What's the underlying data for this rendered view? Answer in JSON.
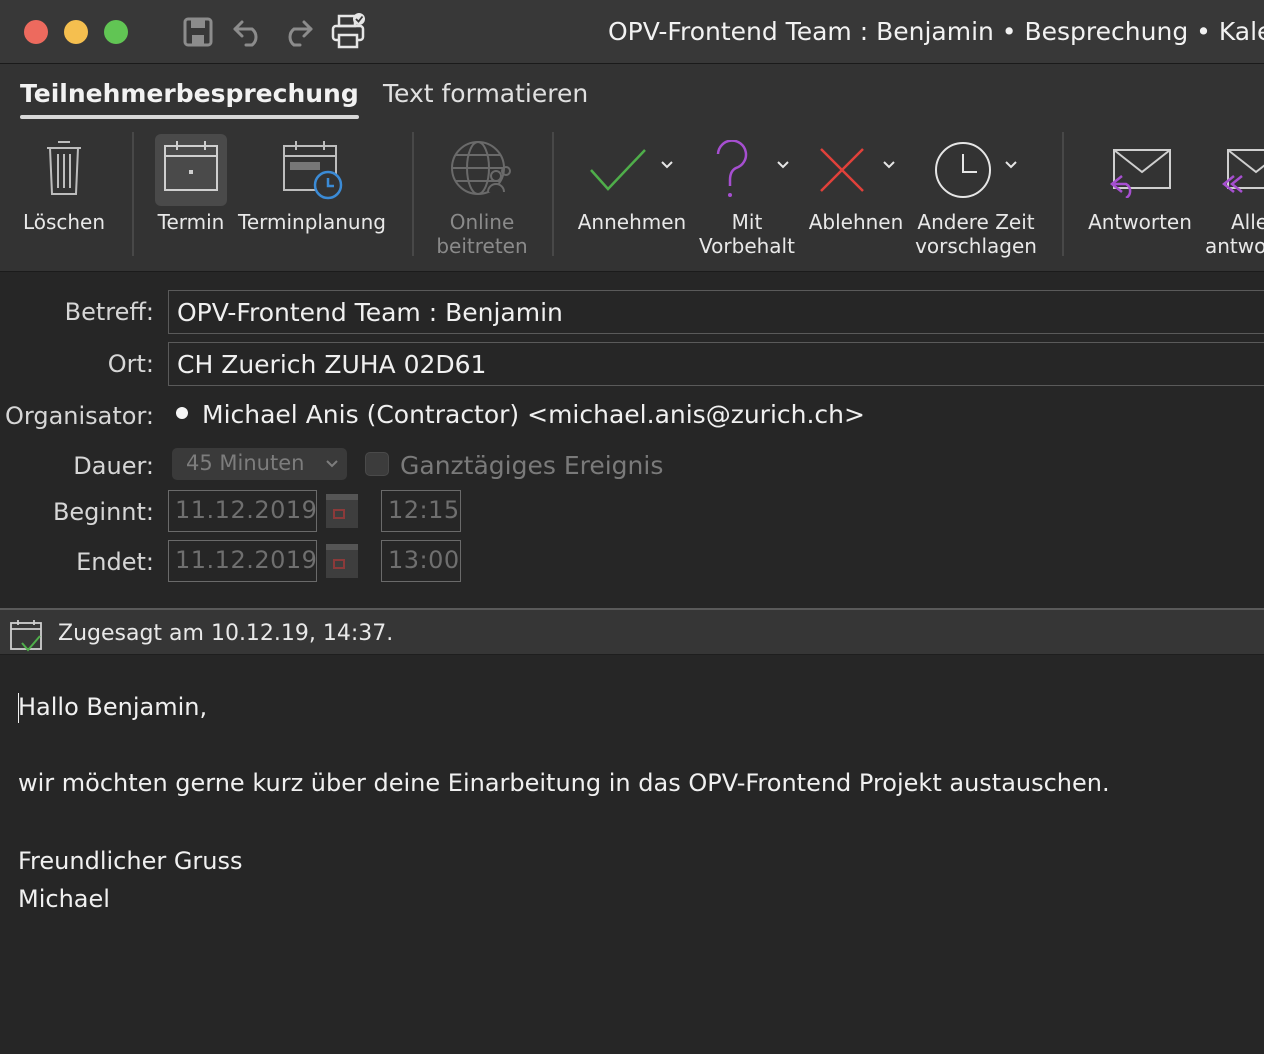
{
  "window": {
    "title": "OPV-Frontend Team : Benjamin • Besprechung • Kalen"
  },
  "tabs": [
    {
      "label": "Teilnehmerbesprechung",
      "active": true
    },
    {
      "label": "Text formatieren",
      "active": false
    }
  ],
  "ribbon": {
    "loeschen": "Löschen",
    "termin": "Termin",
    "terminplanung": "Terminplanung",
    "online_line1": "Online",
    "online_line2": "beitreten",
    "annehmen": "Annehmen",
    "vorbehalt_line1": "Mit",
    "vorbehalt_line2": "Vorbehalt",
    "ablehnen": "Ablehnen",
    "anderezeit_line1": "Andere Zeit",
    "anderezeit_line2": "vorschlagen",
    "antworten": "Antworten",
    "alle_line1": "Alle",
    "alle_line2": "antwo"
  },
  "form": {
    "betreff_label": "Betreff:",
    "betreff_value": "OPV-Frontend Team : Benjamin",
    "ort_label": "Ort:",
    "ort_value": "CH Zuerich ZUHA 02D61",
    "organisator_label": "Organisator:",
    "organisator_value": "Michael Anis (Contractor) <michael.anis@zurich.ch>",
    "dauer_label": "Dauer:",
    "dauer_value": "45 Minuten",
    "ganztaegig_label": "Ganztägiges Ereignis",
    "beginnt_label": "Beginnt:",
    "beginnt_date": "11.12.2019",
    "beginnt_time": "12:15",
    "endet_label": "Endet:",
    "endet_date": "11.12.2019",
    "endet_time": "13:00"
  },
  "status": {
    "text": "Zugesagt am 10.12.19, 14:37."
  },
  "body": {
    "greeting": "Hallo Benjamin,",
    "paragraph": "wir möchten gerne kurz über deine Einarbeitung in das OPV-Frontend Projekt austauschen.",
    "closing": "Freundlicher Gruss",
    "signature": "Michael"
  },
  "colors": {
    "close": "#ed6a5e",
    "minimize": "#f5bf4f",
    "zoom": "#61c554",
    "accept": "#4fae4a",
    "tentative": "#a64fd0",
    "decline": "#e0413a"
  }
}
